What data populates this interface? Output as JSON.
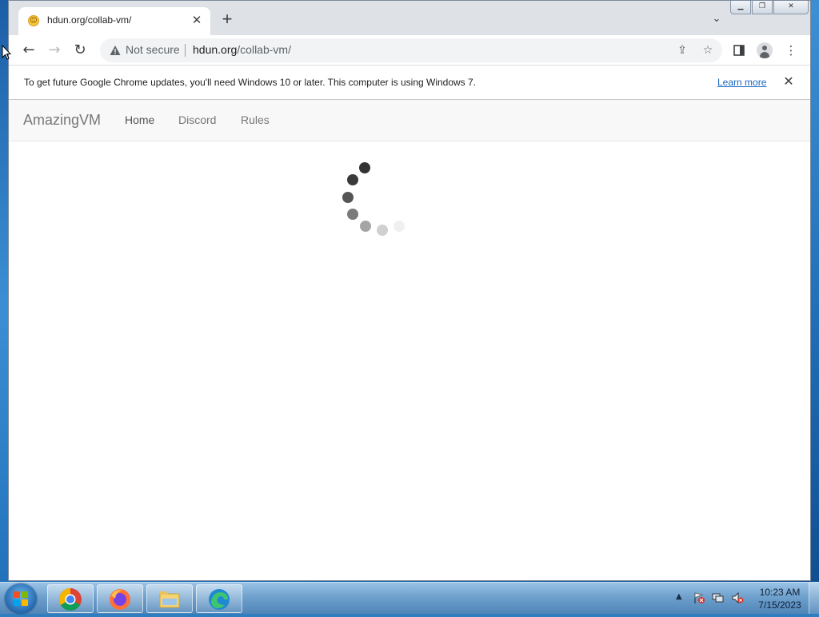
{
  "browser": {
    "tab": {
      "title": "hdun.org/collab-vm/",
      "favicon": "smiley-favicon-icon"
    },
    "new_tab_label": "+",
    "omnibox": {
      "security_label": "Not secure",
      "url_domain": "hdun.org",
      "url_path": "/collab-vm/"
    },
    "infobar": {
      "message": "To get future Google Chrome updates, you'll need Windows 10 or later. This computer is using Windows 7.",
      "link": "Learn more"
    }
  },
  "page": {
    "brand": "AmazingVM",
    "nav": [
      {
        "label": "Home",
        "active": true
      },
      {
        "label": "Discord",
        "active": false
      },
      {
        "label": "Rules",
        "active": false
      }
    ],
    "loading": true
  },
  "taskbar": {
    "pinned": [
      "chrome-icon",
      "firefox-icon",
      "file-explorer-icon",
      "edge-icon"
    ],
    "clock": {
      "time": "10:23 AM",
      "date": "7/15/2023"
    }
  },
  "colors": {
    "chrome_frame": "#dee1e6",
    "link": "#1a66c2",
    "navbar_bg": "#f8f8f8",
    "taskbar": "#6fa1cd"
  }
}
